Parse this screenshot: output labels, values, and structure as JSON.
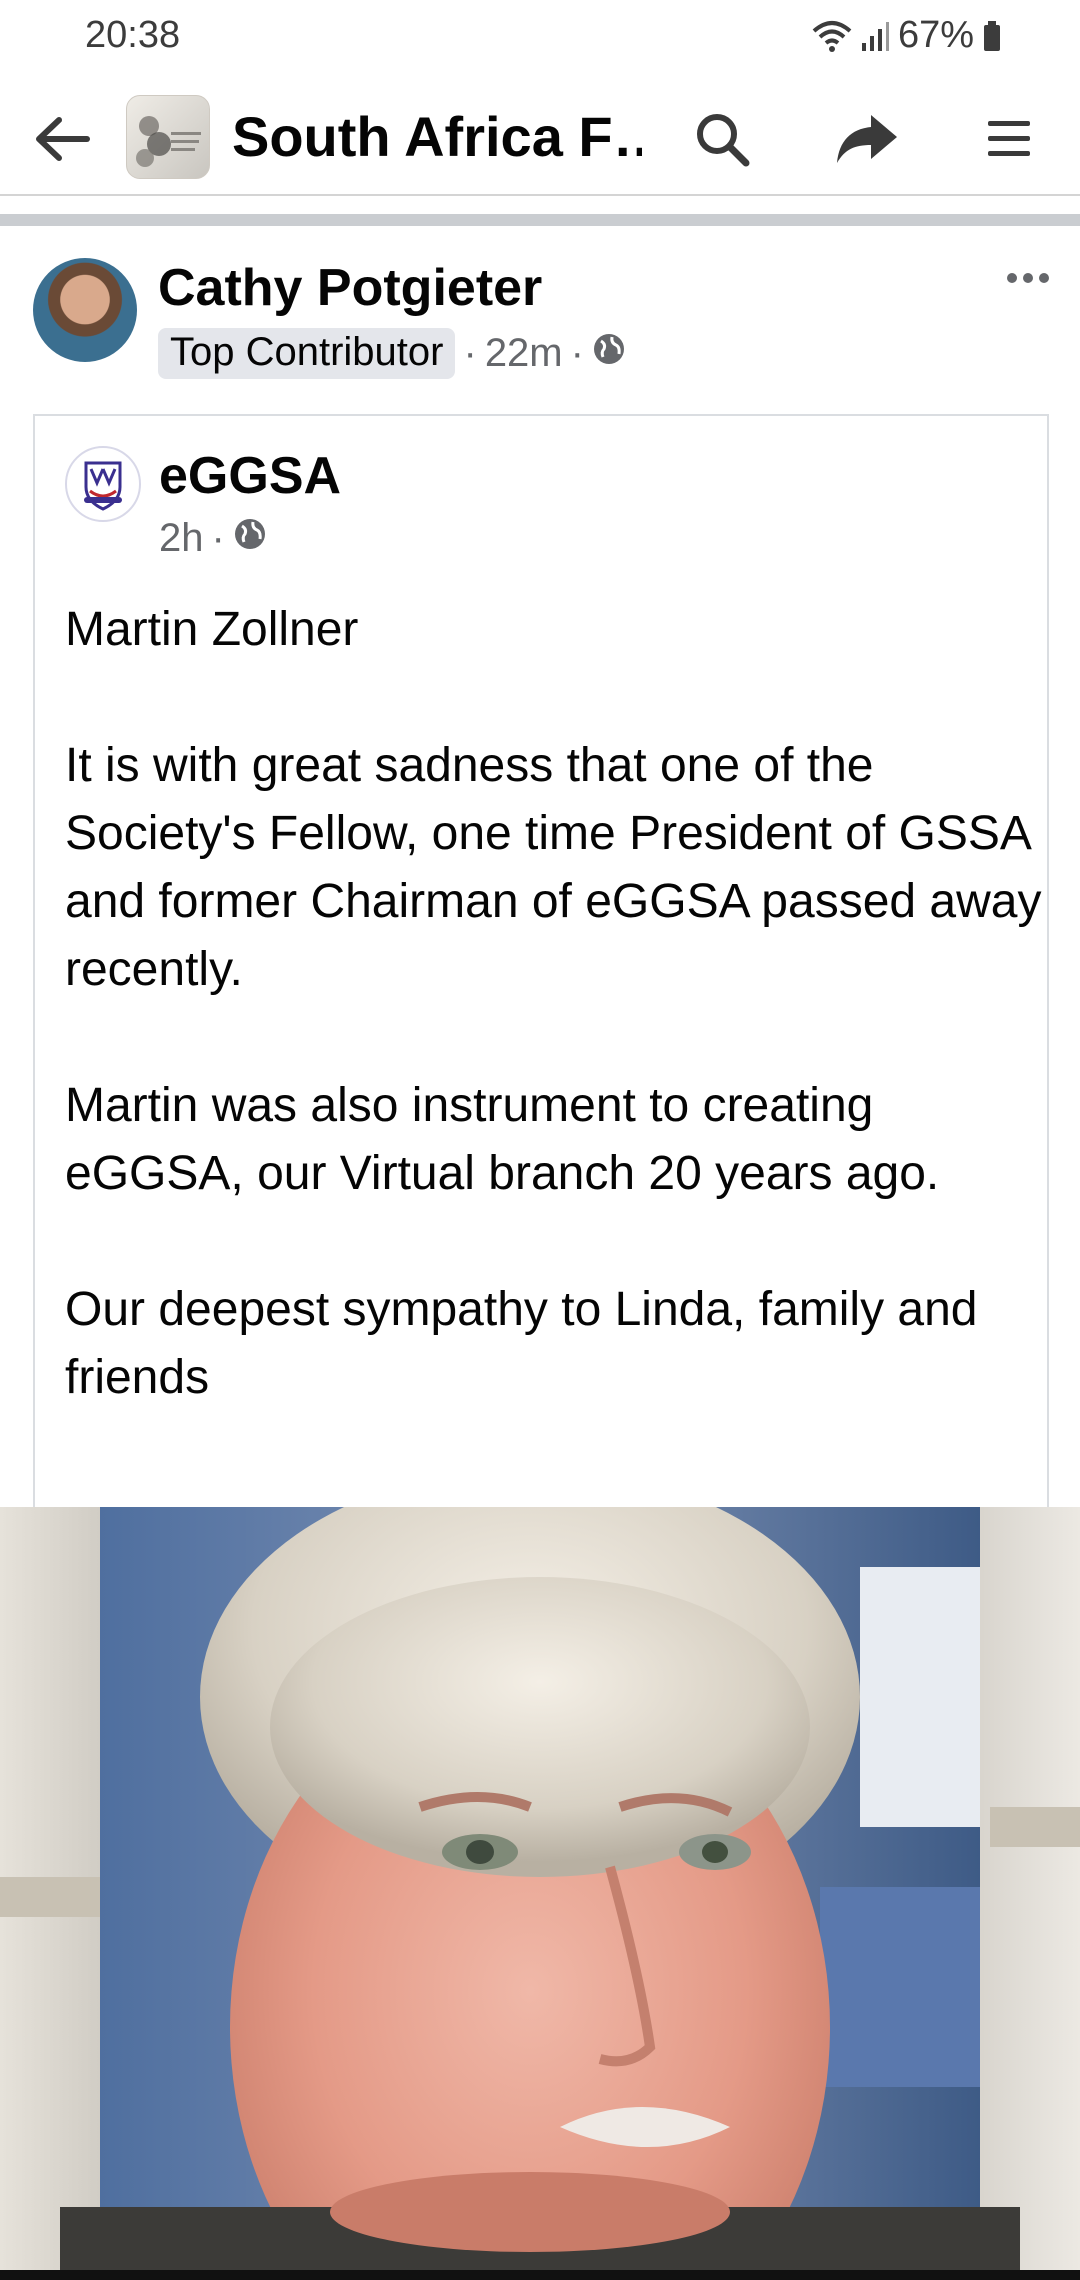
{
  "status_bar": {
    "time": "20:38",
    "battery": "67%",
    "icons": [
      "wifi-icon",
      "signal-icon",
      "battery-icon"
    ]
  },
  "app_bar": {
    "title": "South Africa F…",
    "icons": [
      "back-arrow-icon",
      "search-icon",
      "share-icon",
      "menu-icon"
    ]
  },
  "post": {
    "author": "Cathy Potgieter",
    "badge": "Top Contributor",
    "time": "22m",
    "separator": "·",
    "privacy_icon": "globe-icon",
    "more_icon": "more-dots-icon"
  },
  "shared_post": {
    "page_name": "eGGSA",
    "time": "2h",
    "separator": "·",
    "privacy_icon": "globe-icon",
    "paragraphs": [
      "Martin Zollner",
      "It is with great sadness that one of the Society's Fellow, one time President of GSSA and former Chairman of eGGSA passed away recently.",
      "Martin was also instrument to creating eGGSA, our Virtual branch 20 years ago.",
      "Our deepest sympathy to Linda, family and friends"
    ]
  },
  "colors": {
    "text_primary": "#050505",
    "text_secondary": "#65676b",
    "badge_bg": "#e4e6eb",
    "divider": "#cacdd1"
  }
}
